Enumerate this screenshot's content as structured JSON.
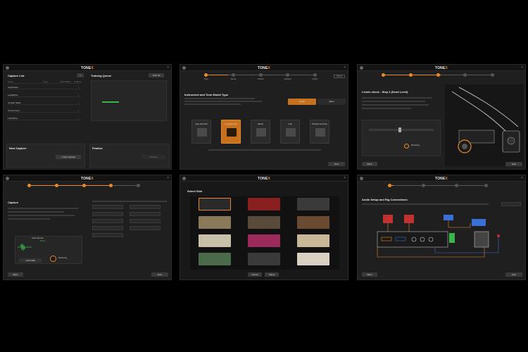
{
  "app": {
    "logo_main": "TONE",
    "logo_accent": "X"
  },
  "panel1": {
    "title": "Capture List",
    "columns": [
      "Name",
      "Type",
      "Guitar/Bass",
      "Capture"
    ],
    "rows": [
      "Amp/Clean",
      "Lead/Drive",
      "Hi-Gain Stack",
      "Crunch Amp",
      "Fuzz/Drive"
    ],
    "training_title": "Training Queue",
    "training_button": "Train All",
    "new_capture_title": "New Capture",
    "new_capture_button": "+ New Capture",
    "finalize_title": "Finalize",
    "finalize_button": "Finalize"
  },
  "panel2": {
    "steps": [
      "Type",
      "Setup",
      "Check",
      "Capture",
      "Finish"
    ],
    "cancel": "Cancel",
    "title": "Instrument and Tone Model Type",
    "instrument_guitar": "Guitar",
    "instrument_bass": "Bass",
    "cards": [
      "Amp and Cab",
      "Complete Rig",
      "Stomp",
      "Amp",
      "Preamp and Amp"
    ],
    "next": "Next"
  },
  "panel3": {
    "title": "Levels check - Step 2 (Send Level)",
    "monitoring": "Monitoring",
    "back": "Back",
    "next": "Next"
  },
  "panel4": {
    "title": "Capture",
    "panel_title": "Audio Injection",
    "panel_sub": "Ready",
    "capture_button": "CAPTURE",
    "monitoring": "Monitoring",
    "back": "Back",
    "next": "Next"
  },
  "panel5": {
    "title": "Select Skin",
    "cancel": "Cancel",
    "select": "Select"
  },
  "panel6": {
    "title": "Audio Setup and Rig Connections",
    "back": "Back",
    "next": "Next"
  },
  "colors": {
    "accent": "#e88a2a",
    "panel": "#1f1f1f",
    "green": "#39b54a",
    "blue": "#3b6fd8",
    "red": "#c23030"
  }
}
